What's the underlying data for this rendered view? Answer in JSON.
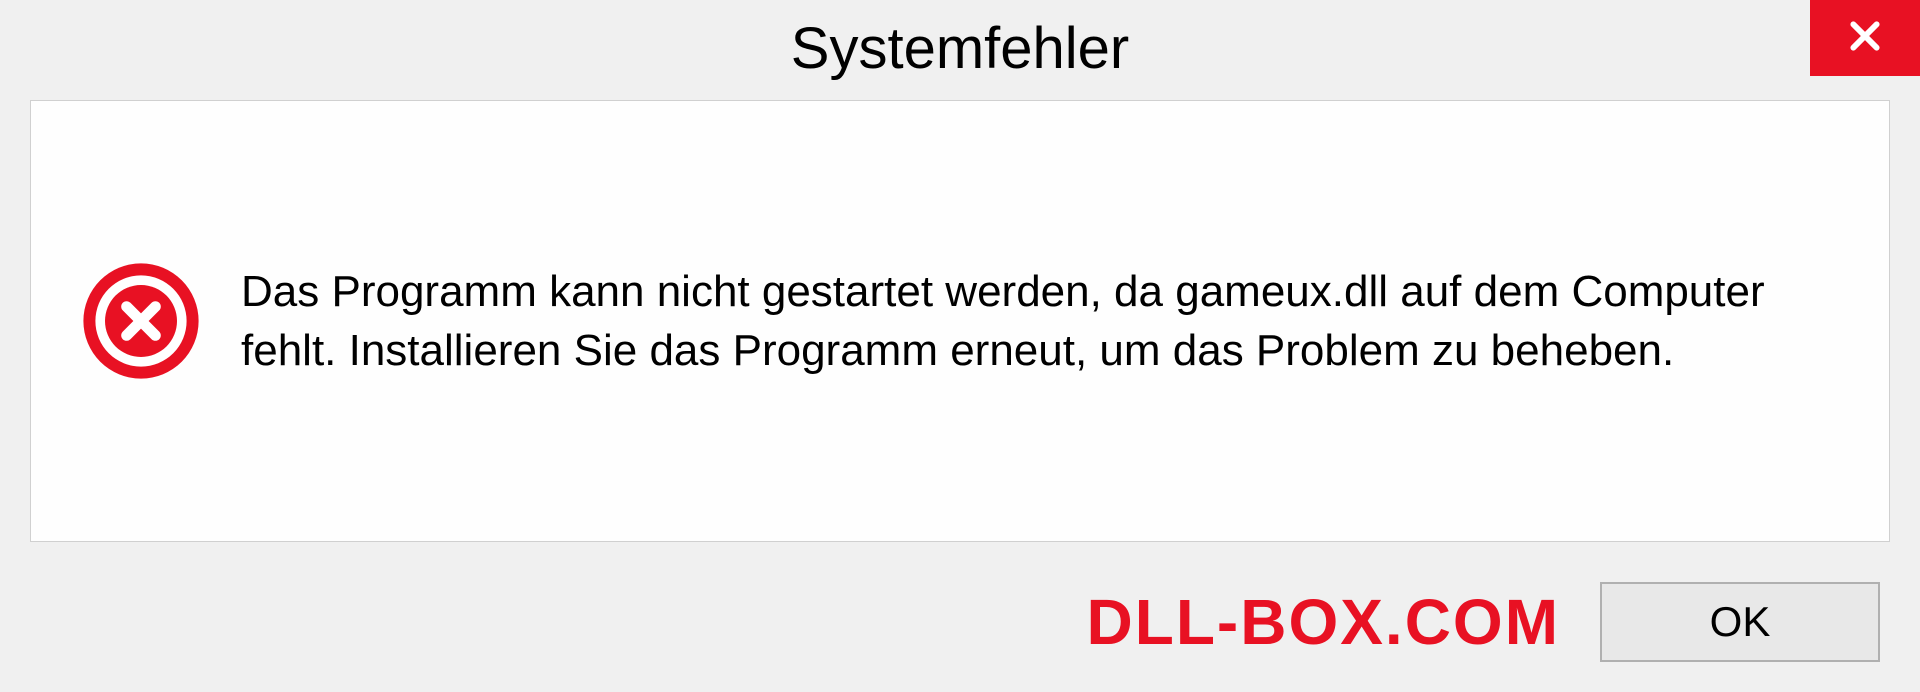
{
  "dialog": {
    "title": "Systemfehler",
    "message": "Das Programm kann nicht gestartet werden, da gameux.dll auf dem Computer fehlt. Installieren Sie das Programm erneut, um das Problem zu beheben.",
    "ok_label": "OK"
  },
  "watermark": "DLL-BOX.COM",
  "colors": {
    "error_red": "#e81123",
    "bg": "#f0f0f0"
  }
}
